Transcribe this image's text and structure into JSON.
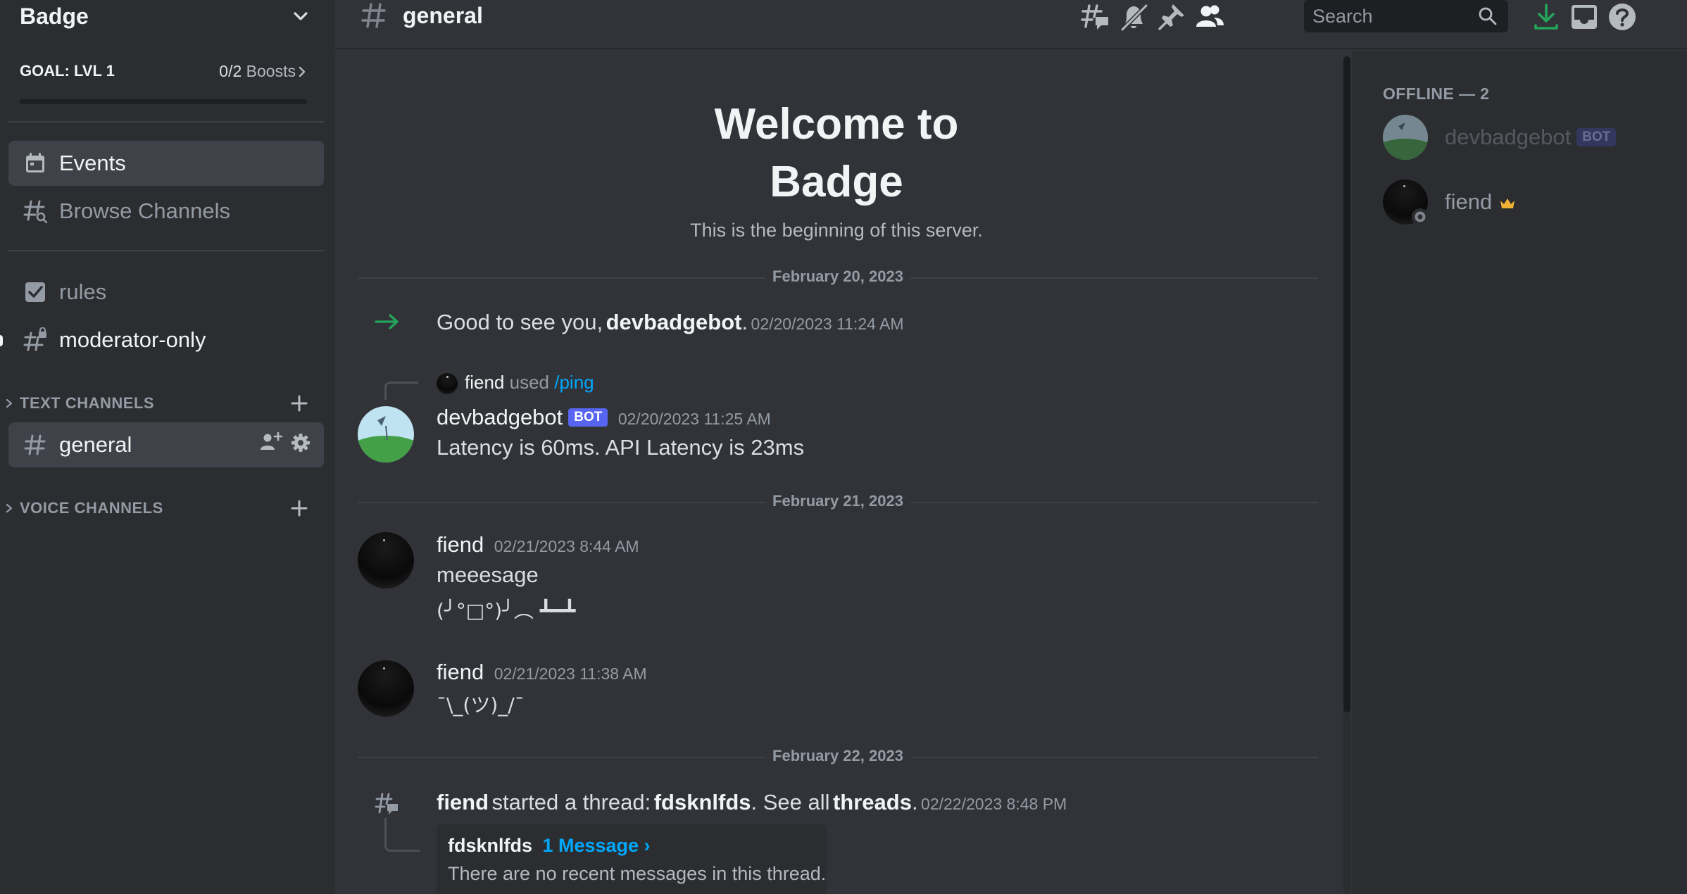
{
  "server": {
    "name": "Badge",
    "boost_goal": "GOAL: LVL 1",
    "boost_count": "0/2",
    "boost_unit": "Boosts",
    "boost_progress": 0
  },
  "sidebar": {
    "top_items": [
      {
        "label": "Events",
        "icon": "calendar-icon"
      },
      {
        "label": "Browse Channels",
        "icon": "browse-channels-icon"
      }
    ],
    "pinned_channels": [
      {
        "label": "rules",
        "icon": "rules-checkbox-icon"
      },
      {
        "label": "moderator-only",
        "icon": "locked-hash-icon"
      }
    ],
    "categories": [
      {
        "label": "TEXT CHANNELS",
        "channels": [
          {
            "label": "general",
            "icon": "hash-icon"
          }
        ]
      },
      {
        "label": "VOICE CHANNELS",
        "channels": []
      }
    ]
  },
  "topbar": {
    "channel_name": "general",
    "search_placeholder": "Search",
    "icons": [
      "threads-icon",
      "mute-icon",
      "pin-icon",
      "members-icon",
      "search-icon",
      "download-icon",
      "inbox-icon",
      "help-icon"
    ]
  },
  "chat": {
    "welcome_title_1": "Welcome to",
    "welcome_title_2": "Badge",
    "welcome_subtitle": "This is the beginning of this server.",
    "dividers": [
      "February 20, 2023",
      "February 21, 2023",
      "February 22, 2023"
    ],
    "join_message": {
      "prefix": "Good to see you,",
      "user": "devbadgebot",
      "suffix": ".",
      "timestamp": "02/20/2023 11:24 AM"
    },
    "command_reply": {
      "invoker": "fiend",
      "used": "used",
      "command": "/ping"
    },
    "messages": [
      {
        "author": "devbadgebot",
        "bot_tag": "BOT",
        "timestamp": "02/20/2023 11:25 AM",
        "lines": [
          "Latency is 60ms. API Latency is 23ms"
        ]
      },
      {
        "author": "fiend",
        "timestamp": "02/21/2023 8:44 AM",
        "lines": [
          "meeesage",
          "(╯°□°)╯︵ ┻━┻"
        ]
      },
      {
        "author": "fiend",
        "timestamp": "02/21/2023 11:38 AM",
        "lines": [
          "¯\\_(ツ)_/¯"
        ]
      }
    ],
    "thread_event": {
      "author": "fiend",
      "started": "started a thread:",
      "thread_name": "fdsknlfds",
      "see_all": ". See all",
      "threads_word": "threads",
      "period": ".",
      "timestamp": "02/22/2023 8:48 PM",
      "card_title": "fdsknlfds",
      "card_link": "1 Message ›",
      "card_body": "There are no recent messages in this thread."
    }
  },
  "members": {
    "section_header": "OFFLINE — 2",
    "list": [
      {
        "name": "devbadgebot",
        "bot_tag": "BOT"
      },
      {
        "name": "fiend",
        "badge": "crown-icon"
      }
    ]
  },
  "colors": {
    "blurple": "#5865f2",
    "link": "#00a8fc",
    "green": "#23a55a",
    "crown": "#f0b232"
  }
}
